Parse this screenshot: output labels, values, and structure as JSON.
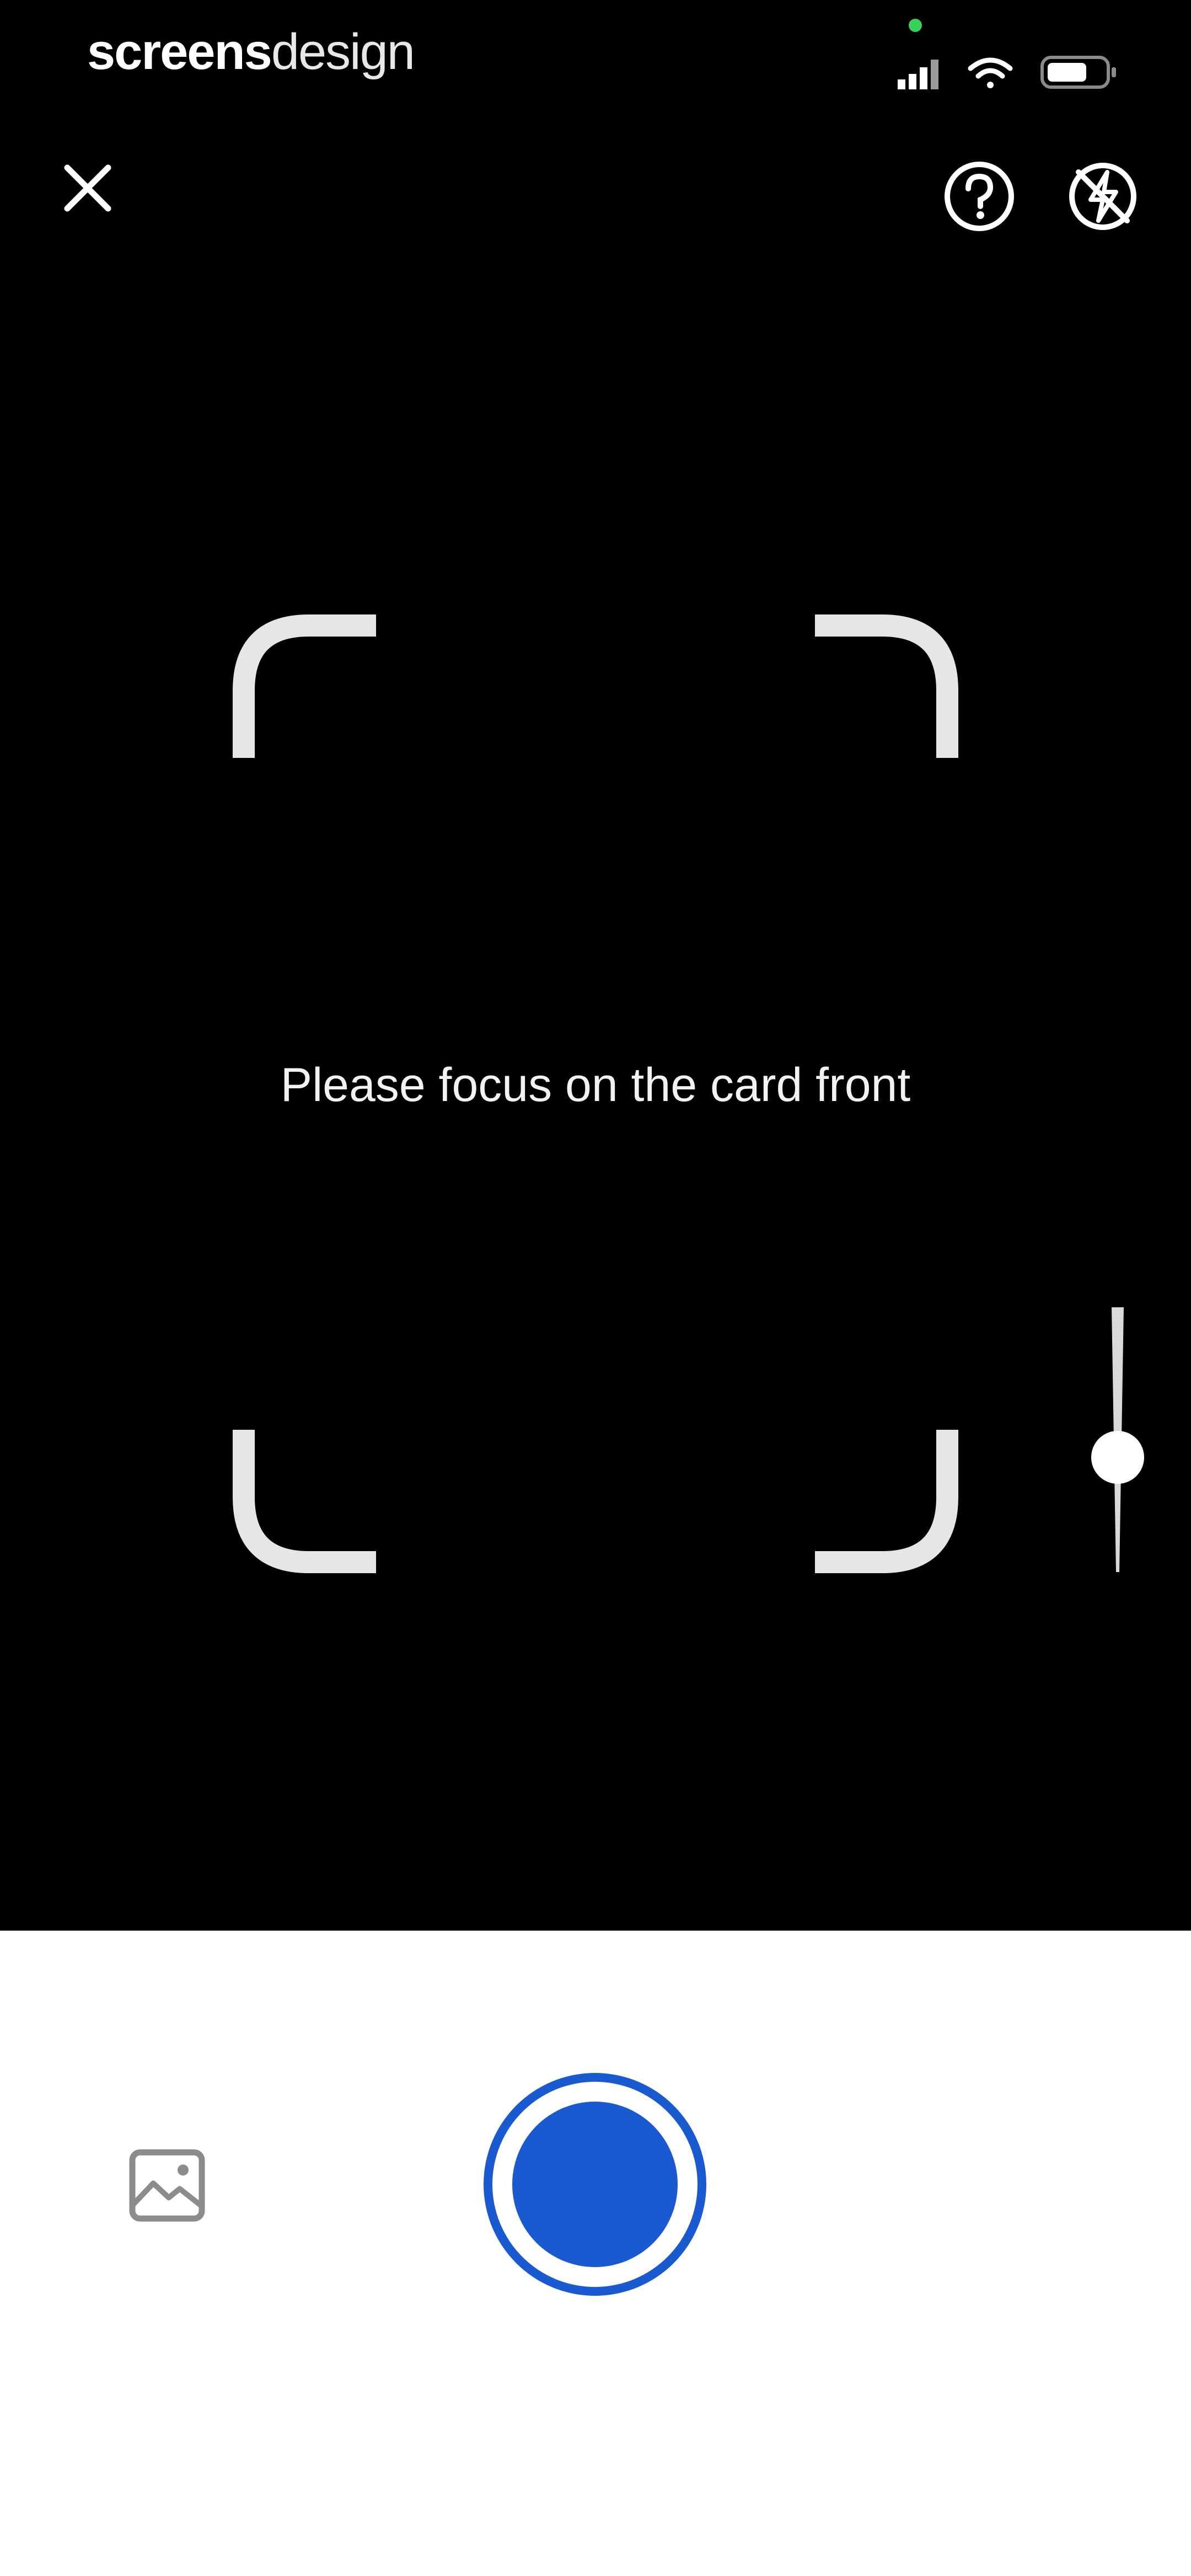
{
  "status_bar": {
    "brand_part1": "screens",
    "brand_part2": "design",
    "indicator_color": "#3ad15a"
  },
  "top_bar": {
    "close_icon": "close-icon",
    "help_icon": "help-circle-icon",
    "flash_icon": "flash-off-icon"
  },
  "viewfinder": {
    "instruction": "Please focus on the card front"
  },
  "zoom": {
    "level": 0.55
  },
  "bottom": {
    "gallery_icon": "gallery-icon",
    "shutter_color": "#1a5ad0"
  },
  "colors": {
    "background": "#000000",
    "panel": "#ffffff",
    "accent": "#1a5ad0"
  }
}
